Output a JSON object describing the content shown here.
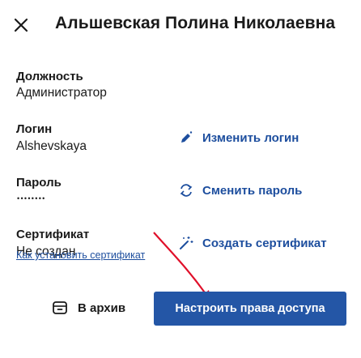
{
  "header": {
    "title": "Альшевская Полина Николаевна",
    "close_icon": "close-icon"
  },
  "fields": {
    "position": {
      "label": "Должность",
      "value": "Администратор"
    },
    "login": {
      "label": "Логин",
      "value": "Alshevskaya"
    },
    "password": {
      "label": "Пароль",
      "value": "••••••••"
    },
    "certificate": {
      "label": "Сертификат",
      "value": "Не создан"
    }
  },
  "actions": {
    "change_login": {
      "label": "Изменить логин",
      "icon": "pencil-icon"
    },
    "change_password": {
      "label": "Сменить пароль",
      "icon": "refresh-icon"
    },
    "create_certificate": {
      "label": "Создать сертификат",
      "icon": "magic-wand-icon"
    }
  },
  "help_link": "Как установить сертификат",
  "footer": {
    "archive_label": "В архив",
    "archive_icon": "archive-box-icon",
    "access_label": "Настроить права доступа"
  },
  "colors": {
    "link": "#1d4e9e",
    "primary_button": "#2456a6",
    "annotation_arrow": "#e0102a"
  }
}
